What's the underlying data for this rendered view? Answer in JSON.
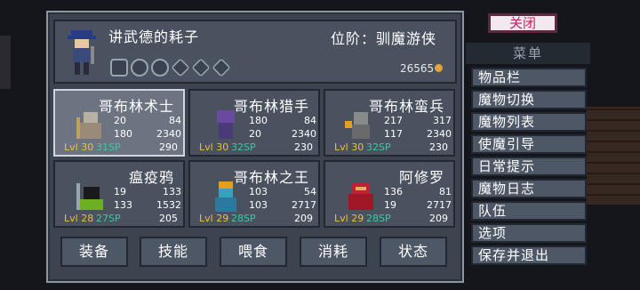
{
  "header": {
    "name": "讲武德的耗子",
    "rank": "位阶：驯魔游侠",
    "gold": "26565"
  },
  "cards": [
    {
      "name": "哥布林术士",
      "stat1": "20",
      "stat1b": "84",
      "stat2": "180",
      "stat2b": "2340",
      "lvl": "Lvl 30",
      "sp": "31SP",
      "hp": "290",
      "selected": true
    },
    {
      "name": "哥布林猎手",
      "stat1": "180",
      "stat1b": "84",
      "stat2": "20",
      "stat2b": "2340",
      "lvl": "Lvl 30",
      "sp": "32SP",
      "hp": "230"
    },
    {
      "name": "哥布林蛮兵",
      "stat1": "217",
      "stat1b": "317",
      "stat2": "117",
      "stat2b": "2340",
      "lvl": "Lvl 30",
      "sp": "32SP",
      "hp": "230"
    },
    {
      "name": "瘟疫鸦",
      "stat1": "19",
      "stat1b": "133",
      "stat2": "133",
      "stat2b": "1532",
      "lvl": "Lvl 28",
      "sp": "27SP",
      "hp": "205"
    },
    {
      "name": "哥布林之王",
      "stat1": "103",
      "stat1b": "54",
      "stat2": "103",
      "stat2b": "2717",
      "lvl": "Lvl 29",
      "sp": "28SP",
      "hp": "209"
    },
    {
      "name": "阿修罗",
      "stat1": "136",
      "stat1b": "81",
      "stat2": "19",
      "stat2b": "2717",
      "lvl": "Lvl 29",
      "sp": "28SP",
      "hp": "209"
    }
  ],
  "buttons": [
    "装备",
    "技能",
    "喂食",
    "消耗",
    "状态"
  ],
  "menu": {
    "close": "关闭",
    "title": "菜单",
    "items": [
      "物品栏",
      "魔物切换",
      "魔物列表",
      "使魔引导",
      "日常提示",
      "魔物日志",
      "队伍",
      "选项",
      "保存并退出"
    ]
  }
}
